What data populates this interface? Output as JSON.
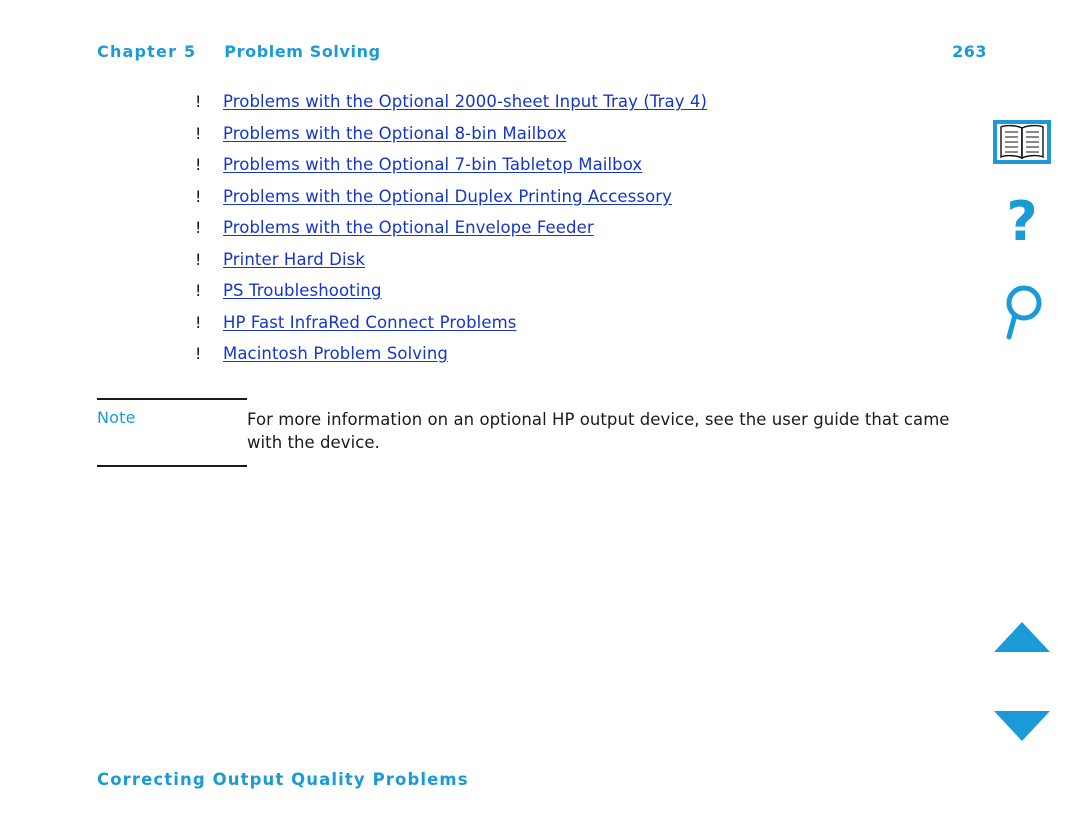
{
  "header": {
    "chapter_label": "Chapter 5",
    "chapter_title": "Problem Solving",
    "page_number": "263"
  },
  "bullets": {
    "marker": "!",
    "items": [
      {
        "label": "Problems with the Optional 2000-sheet Input Tray (Tray 4)"
      },
      {
        "label": "Problems with the Optional 8-bin Mailbox"
      },
      {
        "label": "Problems with the Optional 7-bin Tabletop Mailbox"
      },
      {
        "label": "Problems with the Optional Duplex Printing Accessory"
      },
      {
        "label": "Problems with the Optional Envelope Feeder"
      },
      {
        "label": "Printer Hard Disk"
      },
      {
        "label": "PS Troubleshooting"
      },
      {
        "label": "HP Fast InfraRed Connect Problems"
      },
      {
        "label": "Macintosh Problem Solving"
      }
    ]
  },
  "note": {
    "label": "Note",
    "text": "For more information on an optional HP output device, see the user guide that came with the device."
  },
  "section": {
    "heading": "Correcting Output Quality Problems"
  },
  "nav_icons": [
    {
      "name": "book-icon"
    },
    {
      "name": "question-mark-icon"
    },
    {
      "name": "magnifier-icon"
    },
    {
      "name": "triangle-up-icon"
    },
    {
      "name": "triangle-down-icon"
    }
  ],
  "colors": {
    "accent_cyan": "#1a9bd7",
    "link_blue": "#1535cc",
    "text_black": "#1a1a1a"
  }
}
